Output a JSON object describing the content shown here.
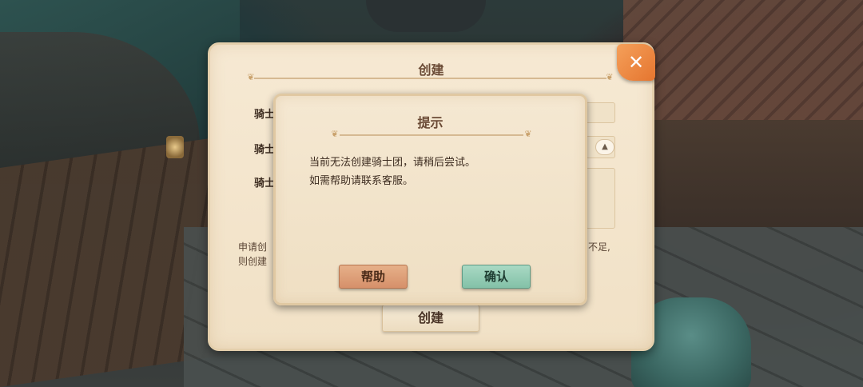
{
  "panel": {
    "title": "创建",
    "labels": [
      "骑士",
      "骑士",
      "骑士"
    ],
    "hint_left": [
      "申请创",
      "则创建"
    ],
    "hint_right": "不足,",
    "create_label": "创建",
    "close_symbol": "✕"
  },
  "dialog": {
    "title": "提示",
    "message_line1": "当前无法创建骑士团，请稍后尝试。",
    "message_line2": "如需帮助请联系客服。",
    "help_label": "帮助",
    "confirm_label": "确认"
  },
  "icons": {
    "leaf": "❦",
    "dropdown": "▲"
  }
}
